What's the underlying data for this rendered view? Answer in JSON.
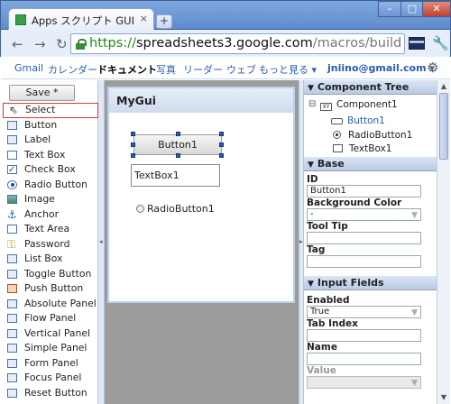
{
  "browser": {
    "tab_title": "Apps スクリプト GUI ...",
    "tab_close": "×",
    "new_tab": "+",
    "win_min": "–",
    "win_max": "□",
    "win_close": "✕",
    "url_scheme": "https://",
    "url_host": "spreadsheets3.google.com",
    "url_path": "/macros/builder?lib=b"
  },
  "googlebar": {
    "items": [
      "Gmail",
      "カレンダー",
      "ドキュメント",
      "写真",
      "リーダー",
      "ウェブ",
      "もっと見る ▾"
    ],
    "active_index": 2,
    "user": "jniino@gmail.com ▾"
  },
  "palette": {
    "save_label": "Save *",
    "items": [
      {
        "label": "Select",
        "icon": "arrow-cursor-icon"
      },
      {
        "label": "Button",
        "icon": "button-icon"
      },
      {
        "label": "Label",
        "icon": "label-icon"
      },
      {
        "label": "Text Box",
        "icon": "textbox-icon"
      },
      {
        "label": "Check Box",
        "icon": "checkbox-icon"
      },
      {
        "label": "Radio Button",
        "icon": "radio-icon"
      },
      {
        "label": "Image",
        "icon": "image-icon"
      },
      {
        "label": "Anchor",
        "icon": "anchor-icon"
      },
      {
        "label": "Text Area",
        "icon": "textarea-icon"
      },
      {
        "label": "Password",
        "icon": "key-icon"
      },
      {
        "label": "List Box",
        "icon": "listbox-icon"
      },
      {
        "label": "Toggle Button",
        "icon": "toggle-icon"
      },
      {
        "label": "Push Button",
        "icon": "pushbutton-icon"
      },
      {
        "label": "Absolute Panel",
        "icon": "absolute-panel-icon"
      },
      {
        "label": "Flow Panel",
        "icon": "flow-panel-icon"
      },
      {
        "label": "Vertical Panel",
        "icon": "vertical-panel-icon"
      },
      {
        "label": "Simple Panel",
        "icon": "simple-panel-icon"
      },
      {
        "label": "Form Panel",
        "icon": "form-panel-icon"
      },
      {
        "label": "Focus Panel",
        "icon": "focus-panel-icon"
      },
      {
        "label": "Reset Button",
        "icon": "reset-button-icon"
      }
    ],
    "selected_index": 0
  },
  "canvas": {
    "gui_title": "MyGui",
    "button_label": "Button1",
    "textbox_value": "TextBox1",
    "radio_label": "RadioButton1"
  },
  "right_panel": {
    "tree_header": "Component Tree",
    "tree_root": "Component1",
    "tree_root_icon_text": "XY",
    "tree_children": [
      "Button1",
      "RadioButton1",
      "TextBox1"
    ],
    "base_header": "Base",
    "id_label": "ID",
    "id_value": "Button1",
    "bg_label": "Background Color",
    "bg_value": "-",
    "tooltip_label": "Tool Tip",
    "tag_label": "Tag",
    "input_header": "Input Fields",
    "enabled_label": "Enabled",
    "enabled_value": "True",
    "tabindex_label": "Tab Index",
    "name_label": "Name",
    "value_label": "Value"
  },
  "colors": {
    "accent": "#2a5db0",
    "selected_border": "#d23a3a",
    "canvas_bg": "#9c9c9c"
  }
}
